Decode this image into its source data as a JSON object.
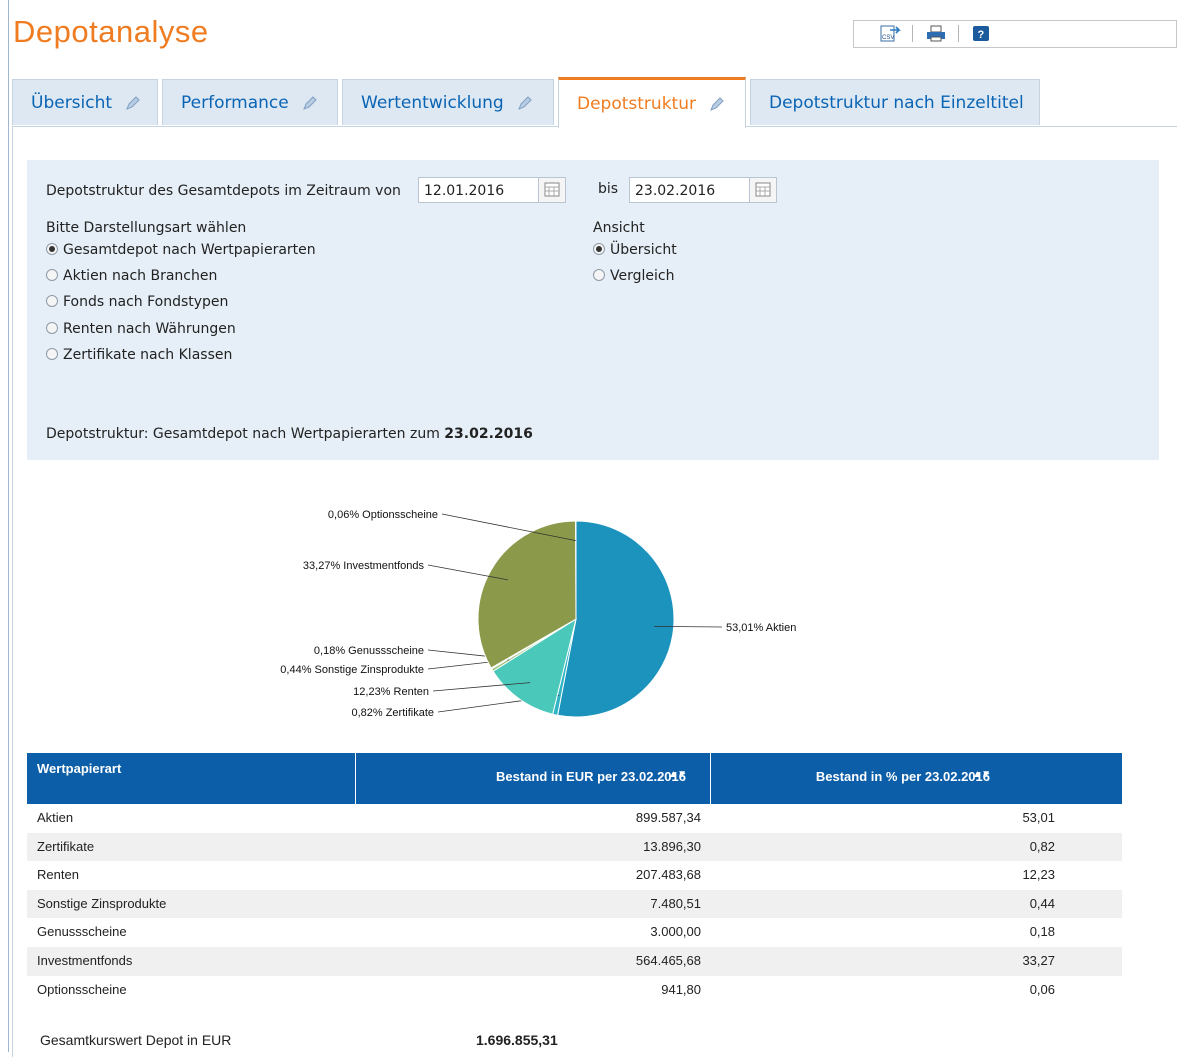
{
  "page": {
    "title": "Depotanalyse"
  },
  "toolbar": {
    "icons": [
      "csv-export-icon",
      "print-icon",
      "help-icon"
    ],
    "csv_label": "CSV",
    "help_label": "?"
  },
  "tabs": [
    {
      "label": "Übersicht",
      "active": false
    },
    {
      "label": "Performance",
      "active": false
    },
    {
      "label": "Wertentwicklung",
      "active": false
    },
    {
      "label": "Depotstruktur",
      "active": true
    },
    {
      "label": "Depotstruktur nach Einzeltitel",
      "active": false
    }
  ],
  "filter": {
    "period_label": "Depotstruktur des Gesamtdepots im Zeitraum von",
    "date_from": "12.01.2016",
    "to_label": "bis",
    "date_to": "23.02.2016",
    "display_label": "Bitte Darstellungsart wählen",
    "display_options": [
      {
        "label": "Gesamtdepot nach Wertpapierarten",
        "selected": true
      },
      {
        "label": "Aktien nach Branchen",
        "selected": false
      },
      {
        "label": "Fonds nach Fondstypen",
        "selected": false
      },
      {
        "label": "Renten nach Währungen",
        "selected": false
      },
      {
        "label": "Zertifikate nach Klassen",
        "selected": false
      }
    ],
    "view_label": "Ansicht",
    "view_options": [
      {
        "label": "Übersicht",
        "selected": true
      },
      {
        "label": "Vergleich",
        "selected": false
      }
    ],
    "summary_prefix": "Depotstruktur: Gesamtdepot nach Wertpapierarten zum",
    "summary_date": "23.02.2016"
  },
  "chart_data": {
    "type": "pie",
    "slices": [
      {
        "name": "Aktien",
        "value": 53.01,
        "label": "53,01% Aktien",
        "color": "#1b93bd"
      },
      {
        "name": "Zertifikate",
        "value": 0.82,
        "label": "0,82% Zertifikate",
        "color": "#2fb4c4"
      },
      {
        "name": "Renten",
        "value": 12.23,
        "label": "12,23% Renten",
        "color": "#4ac9bb"
      },
      {
        "name": "Sonstige Zinsprodukte",
        "value": 0.44,
        "label": "0,44% Sonstige Zinsprodukte",
        "color": "#9bbf7a"
      },
      {
        "name": "Genussscheine",
        "value": 0.18,
        "label": "0,18% Genussscheine",
        "color": "#7fa85c"
      },
      {
        "name": "Investmentfonds",
        "value": 33.27,
        "label": "33,27% Investmentfonds",
        "color": "#8a994a"
      },
      {
        "name": "Optionsscheine",
        "value": 0.06,
        "label": "0,06% Optionsscheine",
        "color": "#6f7f3a"
      }
    ]
  },
  "table": {
    "headers": [
      "Wertpapierart",
      "Bestand in EUR per 23.02.2016",
      "Bestand in % per 23.02.2016"
    ],
    "sort_glyph": "▲▼",
    "rows": [
      [
        "Aktien",
        "899.587,34",
        "53,01"
      ],
      [
        "Zertifikate",
        "13.896,30",
        "0,82"
      ],
      [
        "Renten",
        "207.483,68",
        "12,23"
      ],
      [
        "Sonstige Zinsprodukte",
        "7.480,51",
        "0,44"
      ],
      [
        "Genussscheine",
        "3.000,00",
        "0,18"
      ],
      [
        "Investmentfonds",
        "564.465,68",
        "33,27"
      ],
      [
        "Optionsscheine",
        "941,80",
        "0,06"
      ]
    ],
    "total_label": "Gesamtkurswert Depot in EUR",
    "total_value": "1.696.855,31"
  }
}
